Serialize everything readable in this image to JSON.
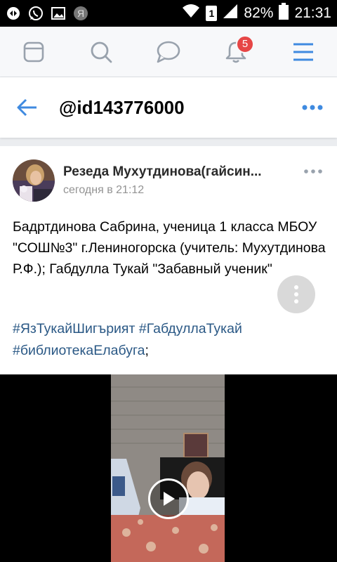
{
  "status_bar": {
    "battery": "82%",
    "time": "21:31",
    "sim": "1",
    "left_icons": [
      "notification-icon",
      "whatsapp-icon",
      "gallery-icon",
      "yandex-icon"
    ]
  },
  "top_nav": {
    "notifications_badge": "5",
    "icons": [
      "feed-icon",
      "search-icon",
      "messages-icon",
      "notifications-icon",
      "menu-icon"
    ]
  },
  "header": {
    "title": "@id143776000"
  },
  "post": {
    "author": "Резеда Мухутдинова(гайсин...",
    "time": "сегодня в 21:12",
    "text": "Бадртдинова Сабрина, ученица 1 класса МБОУ \"СОШ№3\" г.Лениногорска (учитель: Мухутдинова Р.Ф.); Габдулла Тукай \"Забавный ученик\"",
    "tags": [
      "#ЯзТукайШигърият",
      "#ГабдуллаТукай",
      "#библиотекаЕлабуга"
    ],
    "tags_suffix": ";"
  },
  "colors": {
    "accent": "#3f8ae0",
    "link": "#2a5885",
    "badge": "#e64646",
    "muted": "#939393"
  }
}
